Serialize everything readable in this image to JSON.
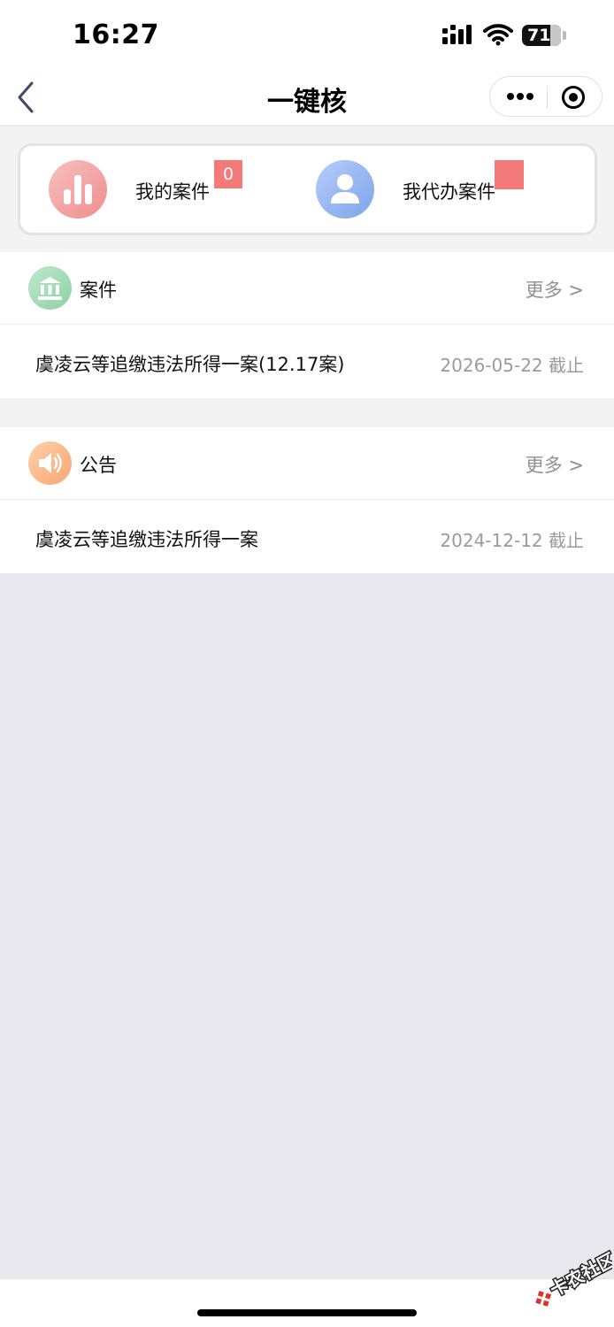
{
  "status_bar": {
    "time": "16:27",
    "battery": "71"
  },
  "nav": {
    "title": "一键核"
  },
  "shortcuts": [
    {
      "label": "我的案件",
      "badge": "0",
      "icon": "bar-chart-icon"
    },
    {
      "label": "我代办案件",
      "badge": "",
      "icon": "person-icon"
    }
  ],
  "cases": {
    "title": "案件",
    "more": "更多 >",
    "icon": "bank-building-icon",
    "item": {
      "title": "虞凌云等追缴违法所得一案(12.17案)",
      "date": "2026-05-22 截止"
    }
  },
  "notices": {
    "title": "公告",
    "more": "更多 >",
    "icon": "speaker-icon",
    "item": {
      "title": "虞凌云等追缴违法所得一案",
      "date": "2024-12-12 截止"
    }
  },
  "watermark": {
    "text": "卡农社区"
  },
  "colors": {
    "badge": "#f47a7a",
    "red_icon": "#ee8d8d",
    "blue_icon": "#7ea4ea",
    "green_icon": "#8ed0a6",
    "orange_icon": "#f9a673"
  }
}
